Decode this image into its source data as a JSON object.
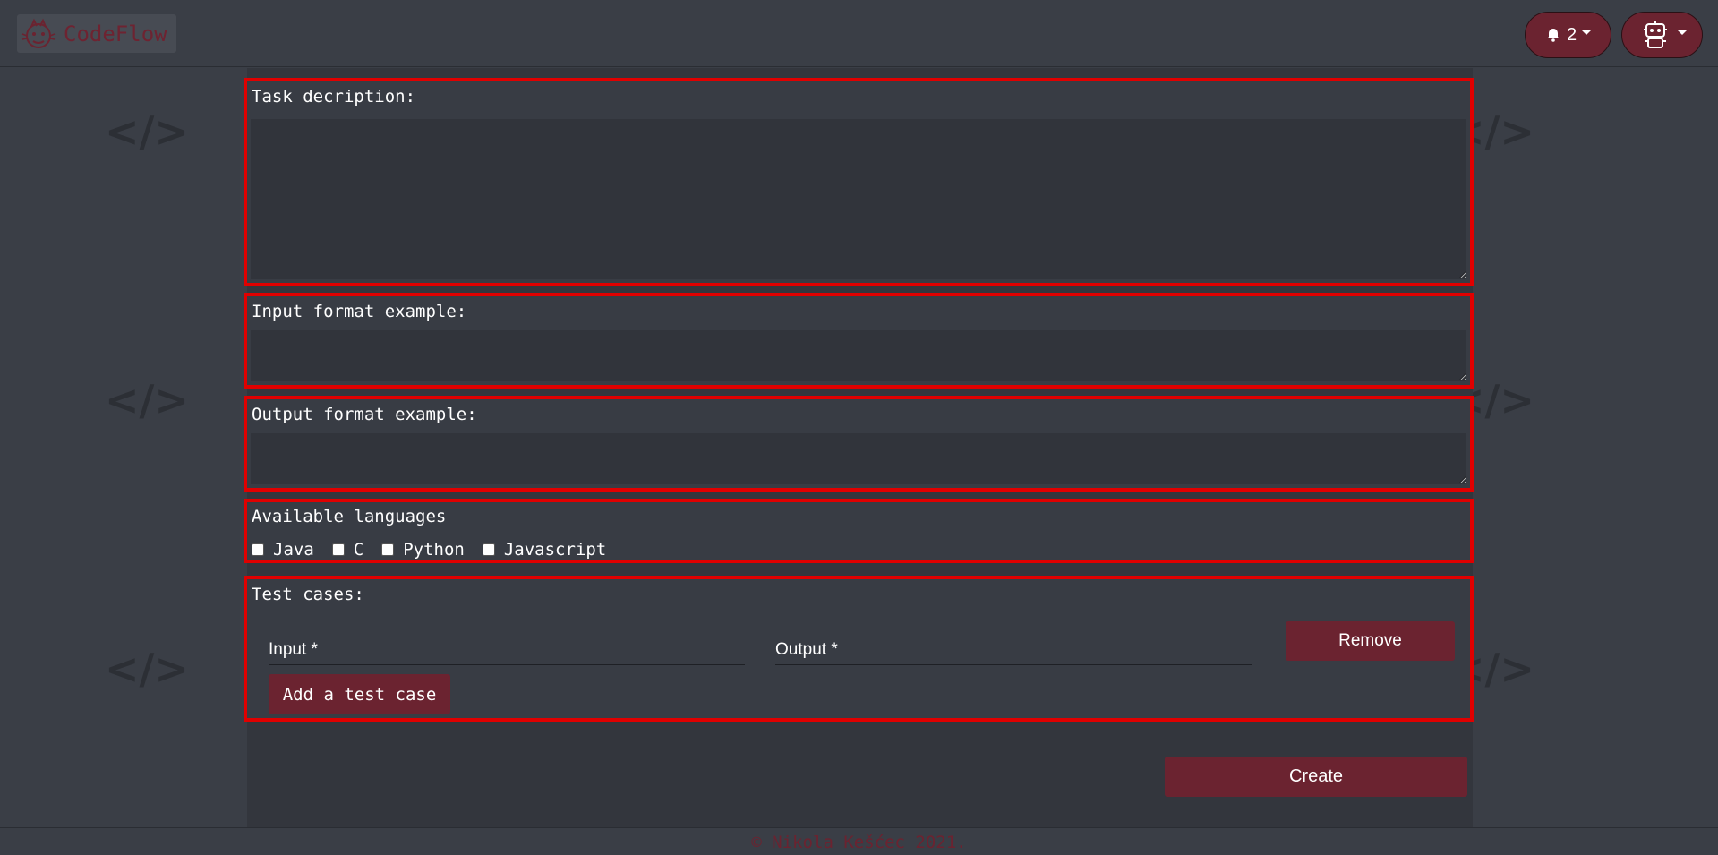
{
  "brand": {
    "name": "CodeFlow",
    "logo_icon": "tiger-logo-icon"
  },
  "header": {
    "notification_count": "2",
    "notification_icon": "bell-icon",
    "avatar_icon": "robot-avatar-icon"
  },
  "background_glyph": "</>",
  "form": {
    "task_description": {
      "label": "Task decription:",
      "value": ""
    },
    "input_format": {
      "label": "Input format example:",
      "value": ""
    },
    "output_format": {
      "label": "Output format example:",
      "value": ""
    },
    "languages": {
      "label": "Available languages",
      "options": [
        {
          "label": "Java",
          "checked": false
        },
        {
          "label": "C",
          "checked": false
        },
        {
          "label": "Python",
          "checked": false
        },
        {
          "label": "Javascript",
          "checked": false
        }
      ]
    },
    "test_cases": {
      "label": "Test cases:",
      "input_placeholder": "Input *",
      "output_placeholder": "Output *",
      "remove_label": "Remove",
      "add_label": "Add a test case"
    },
    "create_label": "Create"
  },
  "footer": {
    "text": "© Nikola Kešćec 2021."
  },
  "colors": {
    "accent": "#6b2330",
    "highlight_border": "#e00000",
    "background": "#3a3e46"
  }
}
